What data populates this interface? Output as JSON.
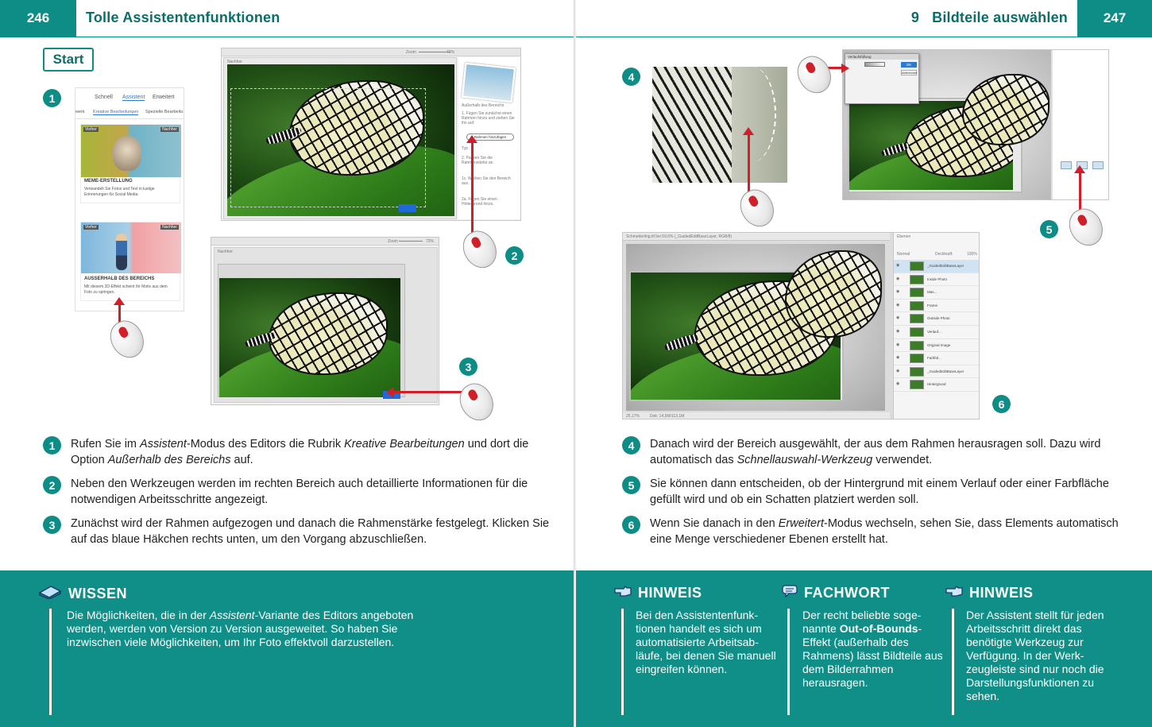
{
  "left": {
    "page_number": "246",
    "header_title": "Tolle Assistentenfunktionen",
    "start_label": "Start",
    "callouts": [
      "1",
      "2",
      "3"
    ],
    "panel1": {
      "tabs": [
        "Schnell",
        "Assistent",
        "Erweitert"
      ],
      "subtabs": [
        "Kreative Bearbeitungen",
        "Spezielle Bearbeitu"
      ],
      "subtab_partial": "werk",
      "card1_title": "MEME-ERSTELLUNG",
      "card1_text": "Verwandelt Sie Fotos und Text in lustige Erinnerungen für Social Media.",
      "card2_title": "AUSSERHALB DES BEREICHS",
      "card2_text": "Mit diesem 3D-Effekt scheint Ihr Motiv aus dem Foto zu springen.",
      "before_label": "Vorher",
      "after_label": "Nachher"
    },
    "shot_top": {
      "window_title": "Nachher",
      "zoom_label": "Zoom",
      "zoom_value": "72%",
      "panel_title": "Außerhalb des Bereichs",
      "panel_lines": [
        "1. Fügen Sie zunächst einen Rahmen hinzu und ziehen Sie ihn auf.",
        "2. Passen Sie die Rahmenstärke an.",
        "Typ",
        "1c. Wählen Sie den Bereich aus.",
        "2a. Fügen Sie einen Hintergrund hinzu."
      ],
      "frame_button": "Rahmen hinzufügen"
    },
    "shot_bottom": {
      "window_title": "Nachher",
      "zoom_label": "Zoom",
      "zoom_value": "72%"
    },
    "steps": [
      {
        "n": "1",
        "parts": [
          [
            "Rufen Sie im ",
            ""
          ],
          [
            "Assistent",
            "i"
          ],
          [
            "-Modus des Editors die Rubrik ",
            ""
          ],
          [
            "Kreative Bearbeitungen",
            "i"
          ],
          [
            " und dort die Option ",
            ""
          ],
          [
            "Außerhalb des Bereichs",
            "i"
          ],
          [
            " auf.",
            ""
          ]
        ]
      },
      {
        "n": "2",
        "parts": [
          [
            "Neben den Werkzeugen werden im rechten Bereich auch detaillierte Infor­mationen für die notwendigen Arbeitsschritte angezeigt.",
            ""
          ]
        ]
      },
      {
        "n": "3",
        "parts": [
          [
            "Zunächst wird der Rahmen aufgezogen und danach die Rahmenstärke festgelegt. Klicken Sie auf das blaue Häkchen rechts unten, um den Vorgang abzuschließen.",
            ""
          ]
        ]
      }
    ],
    "wissen": {
      "title": "WISSEN",
      "parts": [
        [
          "Die Möglichkeiten, die in der ",
          ""
        ],
        [
          "Assistent",
          "i"
        ],
        [
          "-Variante des Editors angeboten werden, werden von Version zu Version ausgeweitet. So haben Sie inzwischen viele Möglichkeiten, um Ihr Foto effektvoll darzustellen.",
          ""
        ]
      ]
    }
  },
  "right": {
    "chapter_number": "9",
    "header_title": "Bildteile auswählen",
    "page_number": "247",
    "callouts": [
      "4",
      "5",
      "6"
    ],
    "dialog": {
      "title": "Verlaufsfüllung",
      "ok": "OK",
      "cancel": "Abbrechen"
    },
    "layers": {
      "tab": "Ebenen",
      "blend": "Normal",
      "opacity_label": "Deckkraft:",
      "opacity": "100%",
      "doc_tab": "Schmetterling.tif bei 59,6% (_GuidedEditBaseLayer, RGB/8)",
      "status": "Dok: 14,5M/113,1M",
      "zoom": "25,17%",
      "names": [
        "_GuidedEditBaseLayer",
        "Inside Photo",
        "Mas...",
        "Frame",
        "Outside Photo",
        "Verlauf...",
        "Original Image",
        "Farbfül...",
        "_GuidedEditBaseLayer",
        "Hintergrund"
      ]
    },
    "steps": [
      {
        "n": "4",
        "parts": [
          [
            "Danach wird der Bereich ausgewählt, der aus dem Rahmen herausragen soll. Dazu wird automatisch das ",
            ""
          ],
          [
            "Schnellauswahl-Werkzeug",
            "i"
          ],
          [
            " verwendet.",
            ""
          ]
        ]
      },
      {
        "n": "5",
        "parts": [
          [
            "Sie können dann entscheiden, ob der Hintergrund mit einem Verlauf oder einer Farbfläche gefüllt wird und ob ein Schatten platziert werden soll.",
            ""
          ]
        ]
      },
      {
        "n": "6",
        "parts": [
          [
            "Wenn Sie danach in den ",
            ""
          ],
          [
            "Erweitert",
            "i"
          ],
          [
            "-Modus wechseln, sehen Sie, dass Elements automatisch eine Menge verschiedener Ebenen erstellt hat.",
            ""
          ]
        ]
      }
    ],
    "hinweis1": {
      "title": "HINWEIS",
      "parts": [
        [
          "Bei den Assistentenfunk­tionen handelt es sich um automatisierte Arbeitsab­läufe, bei denen Sie manuell eingreifen können.",
          ""
        ]
      ]
    },
    "fachwort": {
      "title": "FACHWORT",
      "parts": [
        [
          "Der recht beliebte soge­nannte ",
          ""
        ],
        [
          "Out-of-Bounds",
          "b"
        ],
        [
          "-Effekt (außerhalb des Rahmens) lässt Bildteile aus dem Bilderrahmen herausragen.",
          ""
        ]
      ]
    },
    "hinweis2": {
      "title": "HINWEIS",
      "parts": [
        [
          "Der Assistent stellt für jeden Arbeitsschritt direkt das benötigte Werkzeug zur Verfügung. In der Werk­zeugleiste sind nur noch die Darstellungsfunktionen zu sehen.",
          ""
        ]
      ]
    }
  },
  "colors": {
    "teal": "#0e8d87",
    "teal_dark": "#0b6e68",
    "red": "#d11f2a"
  }
}
